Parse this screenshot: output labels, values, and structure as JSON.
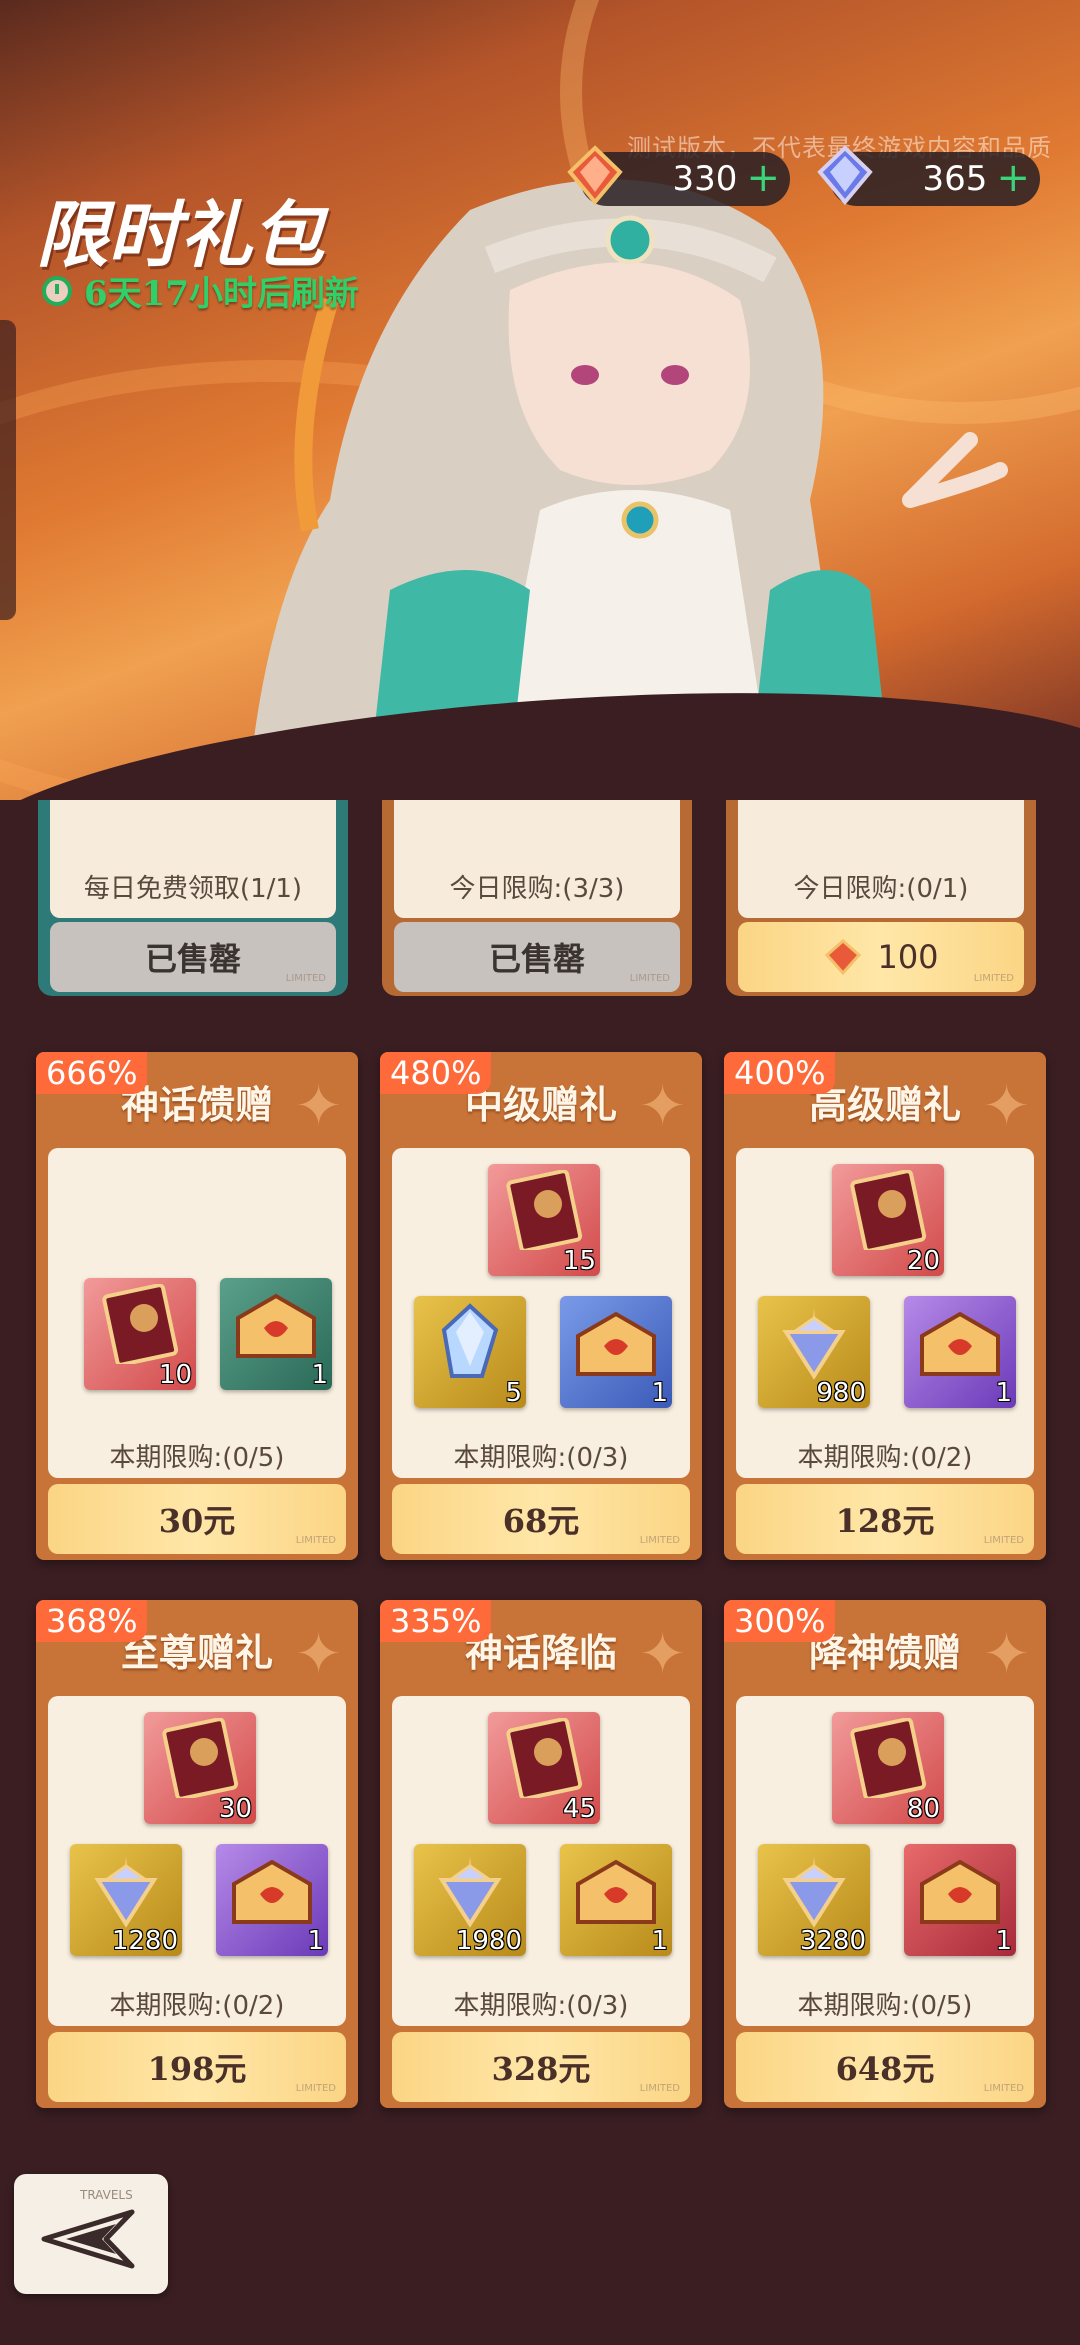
{
  "banner": {
    "title": "限时礼包",
    "timer_text": "6天17小时后刷新",
    "watermark": "测试版本，不代表最终游戏内容和品质"
  },
  "currencies": [
    {
      "icon": "red-crystal-icon",
      "value": "330"
    },
    {
      "icon": "blue-crystal-icon",
      "value": "365"
    }
  ],
  "top_cards": [
    {
      "limit": "每日免费领取(1/1)",
      "button": "已售罄",
      "state": "sold"
    },
    {
      "limit": "今日限购:(3/3)",
      "button": "已售罄",
      "state": "sold"
    },
    {
      "limit": "今日限购:(0/1)",
      "button": "100",
      "state": "buy"
    }
  ],
  "packs": [
    {
      "badge": "666%",
      "title": "神话馈赠",
      "limit": "本期限购:(0/5)",
      "price": "30元",
      "items": [
        {
          "type": "card",
          "color": "red",
          "count": "10"
        },
        {
          "type": "chest",
          "color": "green",
          "count": "1"
        }
      ]
    },
    {
      "badge": "480%",
      "title": "中级赠礼",
      "limit": "本期限购:(0/3)",
      "price": "68元",
      "items": [
        {
          "type": "card",
          "color": "red",
          "count": "15"
        },
        {
          "type": "crystal",
          "color": "gold",
          "count": "5"
        },
        {
          "type": "chest",
          "color": "blue",
          "count": "1"
        }
      ]
    },
    {
      "badge": "400%",
      "title": "高级赠礼",
      "limit": "本期限购:(0/2)",
      "price": "128元",
      "items": [
        {
          "type": "card",
          "color": "red",
          "count": "20"
        },
        {
          "type": "gem",
          "color": "gold",
          "count": "980"
        },
        {
          "type": "chest",
          "color": "purple",
          "count": "1"
        }
      ]
    },
    {
      "badge": "368%",
      "title": "至尊赠礼",
      "limit": "本期限购:(0/2)",
      "price": "198元",
      "items": [
        {
          "type": "card",
          "color": "red",
          "count": "30"
        },
        {
          "type": "gem",
          "color": "gold",
          "count": "1280"
        },
        {
          "type": "chest",
          "color": "purple",
          "count": "1"
        }
      ]
    },
    {
      "badge": "335%",
      "title": "神话降临",
      "limit": "本期限购:(0/3)",
      "price": "328元",
      "items": [
        {
          "type": "card",
          "color": "red",
          "count": "45"
        },
        {
          "type": "gem",
          "color": "gold",
          "count": "1980"
        },
        {
          "type": "chest",
          "color": "gold",
          "count": "1"
        }
      ]
    },
    {
      "badge": "300%",
      "title": "降神馈赠",
      "limit": "本期限购:(0/5)",
      "price": "648元",
      "items": [
        {
          "type": "card",
          "color": "red",
          "count": "80"
        },
        {
          "type": "gem",
          "color": "gold",
          "count": "3280"
        },
        {
          "type": "chest",
          "color": "crimson",
          "count": "1"
        }
      ]
    }
  ],
  "back": {
    "icon": "back-arrow-icon",
    "label": "TRAVELS"
  }
}
